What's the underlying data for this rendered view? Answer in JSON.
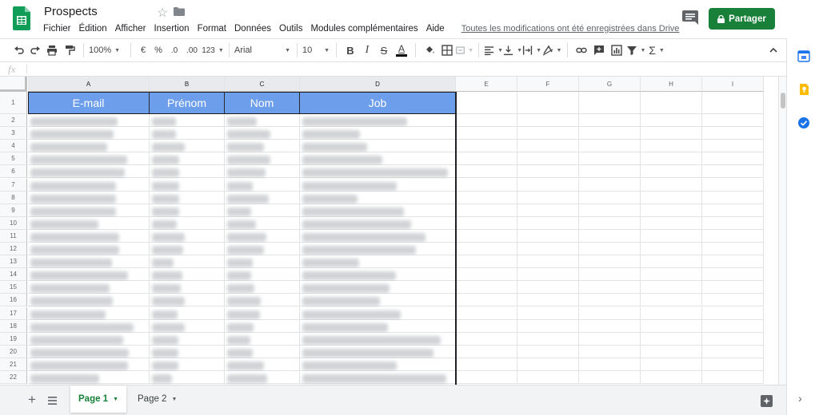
{
  "document": {
    "title": "Prospects",
    "save_status": "Toutes les modifications ont été enregistrées dans Drive"
  },
  "menu": [
    "Fichier",
    "Édition",
    "Afficher",
    "Insertion",
    "Format",
    "Données",
    "Outils",
    "Modules complémentaires",
    "Aide"
  ],
  "share": {
    "label": "Partager"
  },
  "toolbar": {
    "zoom": "100%",
    "currency": "€",
    "percent": "%",
    "decrease_decimals": ".0",
    "increase_decimals": ".00",
    "more_formats": "123",
    "font": "Arial",
    "font_size": "10",
    "bold": "B",
    "italic": "I",
    "strikethrough": "S",
    "text_color": "A"
  },
  "formula_bar": {
    "label": "fx",
    "value": ""
  },
  "grid": {
    "columns": [
      "A",
      "B",
      "C",
      "D",
      "E",
      "F",
      "G",
      "H",
      "I"
    ],
    "rows": [
      "1",
      "2",
      "3",
      "4",
      "5",
      "6",
      "7",
      "8",
      "9",
      "10",
      "11",
      "12",
      "13",
      "14",
      "15",
      "16",
      "17",
      "18",
      "19",
      "20",
      "21",
      "22"
    ],
    "header_row": [
      "E-mail",
      "Prénom",
      "Nom",
      "Job"
    ],
    "header_color": "#6d9eeb"
  },
  "sheets": [
    {
      "label": "Page 1",
      "active": true
    },
    {
      "label": "Page 2",
      "active": false
    }
  ],
  "colors": {
    "share_button": "#188038",
    "active_tab_text": "#188038",
    "header_fill": "#6d9eeb"
  },
  "icons": [
    "sheets-logo-icon",
    "star-icon",
    "folder-icon",
    "comments-icon",
    "lock-icon",
    "calendar-icon",
    "keep-icon",
    "tasks-icon",
    "explore-icon"
  ]
}
